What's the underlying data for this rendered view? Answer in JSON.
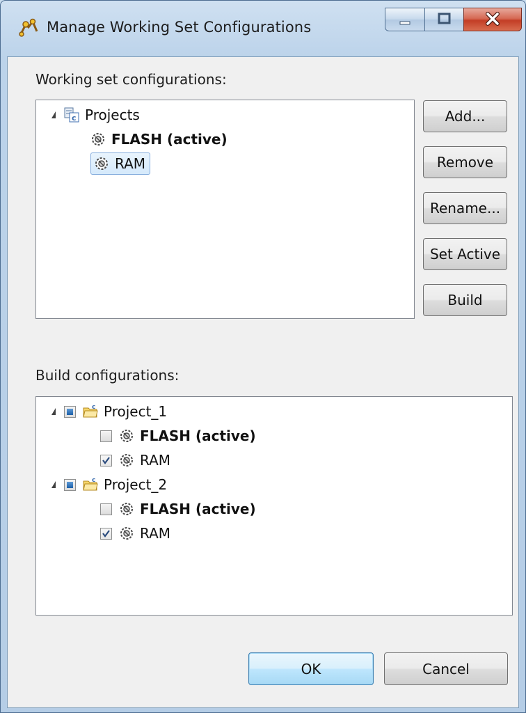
{
  "window": {
    "title": "Manage Working Set Configurations"
  },
  "working_set": {
    "label": "Working set configurations:",
    "root": "Projects",
    "items": [
      {
        "label": "FLASH (active)",
        "bold": true
      },
      {
        "label": "RAM",
        "selected": true
      }
    ]
  },
  "side_buttons": [
    "Add...",
    "Remove",
    "Rename...",
    "Set Active",
    "Build"
  ],
  "build_config": {
    "label": "Build configurations:",
    "projects": [
      {
        "name": "Project_1",
        "configs": [
          {
            "label": "FLASH (active)",
            "checked": false
          },
          {
            "label": "RAM",
            "checked": true
          }
        ]
      },
      {
        "name": "Project_2",
        "configs": [
          {
            "label": "FLASH (active)",
            "checked": false
          },
          {
            "label": "RAM",
            "checked": true
          }
        ]
      }
    ]
  },
  "footer": {
    "ok": "OK",
    "cancel": "Cancel"
  }
}
